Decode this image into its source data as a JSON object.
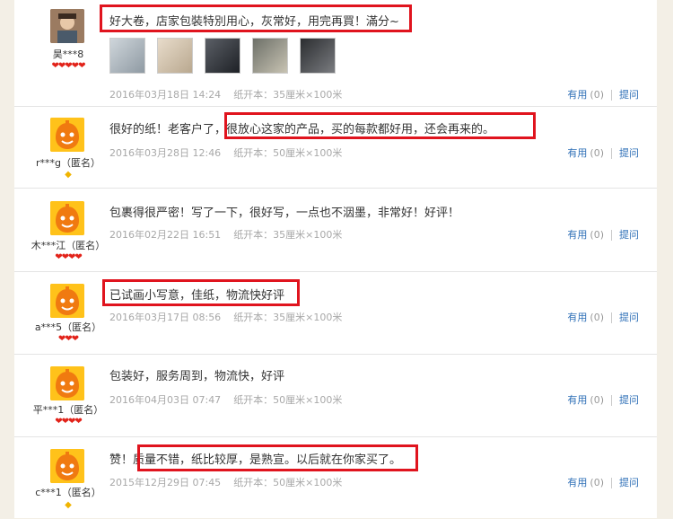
{
  "reviews": [
    {
      "user": "昊***8",
      "anonymous": "",
      "avatar": "photo",
      "rank": "hearts",
      "rank_glyphs": "❤❤❤❤❤",
      "pre": "",
      "comment": "好大卷，店家包裝特別用心，灰常好，用完再買！滿分~",
      "date": "2016年03月18日 14:24",
      "spec": "纸开本：35厘米×100米",
      "useful": "有用",
      "count": "(0)",
      "ask": "提问",
      "thumbs": [
        "photo-1",
        "photo-2",
        "photo-3",
        "photo-4",
        "photo-5"
      ]
    },
    {
      "user": "r***g（匿名）",
      "avatar": "mascot",
      "rank": "diamond",
      "rank_glyphs": "◆",
      "pre": "很好的纸！老客户了，",
      "comment": "很放心这家的产品，买的每款都好用，还会再来的。",
      "date": "2016年03月28日 12:46",
      "spec": "纸开本：50厘米×100米",
      "useful": "有用",
      "count": "(0)",
      "ask": "提问"
    },
    {
      "user": "木***江（匿名）",
      "avatar": "mascot",
      "rank": "hearts",
      "rank_glyphs": "❤❤❤❤",
      "pre": "",
      "comment": "包裹得很严密！写了一下，很好写，一点也不洇墨，非常好！好评！",
      "date": "2016年02月22日 16:51",
      "spec": "纸开本：35厘米×100米",
      "useful": "有用",
      "count": "(0)",
      "ask": "提问"
    },
    {
      "user": "a***5（匿名）",
      "avatar": "mascot",
      "rank": "hearts",
      "rank_glyphs": "❤❤❤",
      "pre": "",
      "comment": "已试画小写意，佳纸，物流快好评",
      "date": "2016年03月17日 08:56",
      "spec": "纸开本：35厘米×100米",
      "useful": "有用",
      "count": "(0)",
      "ask": "提问"
    },
    {
      "user": "平***1（匿名）",
      "avatar": "mascot",
      "rank": "hearts",
      "rank_glyphs": "❤❤❤❤",
      "pre": "",
      "comment": "包装好，服务周到，物流快，好评",
      "date": "2016年04月03日 07:47",
      "spec": "纸开本：50厘米×100米",
      "useful": "有用",
      "count": "(0)",
      "ask": "提问"
    },
    {
      "user": "c***1（匿名）",
      "avatar": "mascot",
      "rank": "diamond",
      "rank_glyphs": "◆",
      "pre": "赞！",
      "comment": "质量不错，纸比较厚，是熟宣。以后就在你家买了。",
      "date": "2015年12月29日 07:45",
      "spec": "纸开本：50厘米×100米",
      "useful": "有用",
      "count": "(0)",
      "ask": "提问"
    }
  ],
  "colors": {
    "highlight": "#e0141e",
    "link": "#2e6fb7",
    "mascot": "#ffc21a",
    "heart": "#e2231a"
  }
}
